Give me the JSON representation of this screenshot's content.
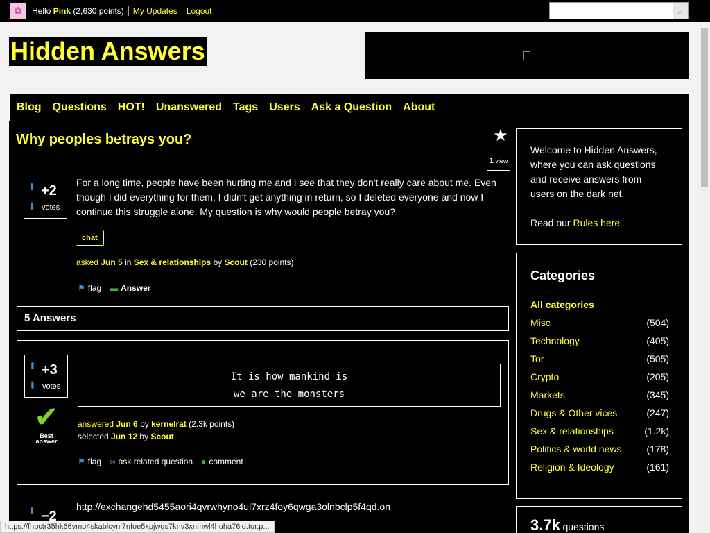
{
  "userbar": {
    "hello_prefix": "Hello",
    "username": "Pink",
    "points": "(2,630 points)",
    "my_updates": "My Updates",
    "logout": "Logout"
  },
  "search": {
    "placeholder": ""
  },
  "site": {
    "logo": "Hidden Answers"
  },
  "nav": [
    "Blog",
    "Questions",
    "HOT!",
    "Unanswered",
    "Tags",
    "Users",
    "Ask a Question",
    "About"
  ],
  "question": {
    "title": "Why peoples betrays you?",
    "views_count": "1",
    "views_label": "view",
    "votes": "+2",
    "votes_label": "votes",
    "body": "For a long time, people have been hurting me and I see that they don't really care about me. Even though I did everything for them, I didn't get anything in return, so I deleted everyone and now I continue this struggle alone. My question is why would people betray you?",
    "tag": "chat",
    "asked_label": "asked",
    "asked_date": "Jun 5",
    "in_label": "in",
    "category": "Sex & relationships",
    "by_label": "by",
    "author": "Scout",
    "author_points": "(230 points)",
    "flag": "flag",
    "answer": "Answer"
  },
  "answers_header": "5 Answers",
  "answer1": {
    "votes": "+3",
    "votes_label": "votes",
    "quote_line1": "It is how mankind is",
    "quote_line2": "we are the monsters",
    "best_label": "Best answer",
    "answered_label": "answered",
    "answered_date": "Jun 6",
    "by_label": "by",
    "author": "kernelrat",
    "author_points": "(2.3k points)",
    "selected_label": "selected",
    "selected_date": "Jun 12",
    "selected_by": "Scout",
    "flag": "flag",
    "related": "ask related question",
    "comment": "comment"
  },
  "answer2": {
    "votes": "−2",
    "url": "http://exchangehd5455aori4qvrwhyno4ul7xrz4foy6qwga3olnbclp5f4qd.on"
  },
  "sidebar": {
    "welcome_text": "Welcome to Hidden Answers, where you can ask questions and receive answers from users on the dark net.",
    "rules_prefix": "Read our",
    "rules_link": "Rules here",
    "categories_title": "Categories",
    "all_categories": "All categories",
    "categories": [
      {
        "name": "Misc",
        "count": "(504)"
      },
      {
        "name": "Technology",
        "count": "(405)"
      },
      {
        "name": "Tor",
        "count": "(505)"
      },
      {
        "name": "Crypto",
        "count": "(205)"
      },
      {
        "name": "Markets",
        "count": "(345)"
      },
      {
        "name": "Drugs & Other vices",
        "count": "(247)"
      },
      {
        "name": "Sex & relationships",
        "count": "(1.2k)"
      },
      {
        "name": "Politics & world news",
        "count": "(178)"
      },
      {
        "name": "Religion & Ideology",
        "count": "(161)"
      }
    ],
    "stats_number": "3.7k",
    "stats_label": "questions"
  },
  "statusbar": "https://fnpctr35hk66vmo4skablcyni7nfoe5xpjwqs7knv3xnmwl4huha76id.tor.p...",
  "colors": {
    "accent": "#ffff33",
    "background": "#000000",
    "vote_arrow": "#3a8fd9"
  }
}
